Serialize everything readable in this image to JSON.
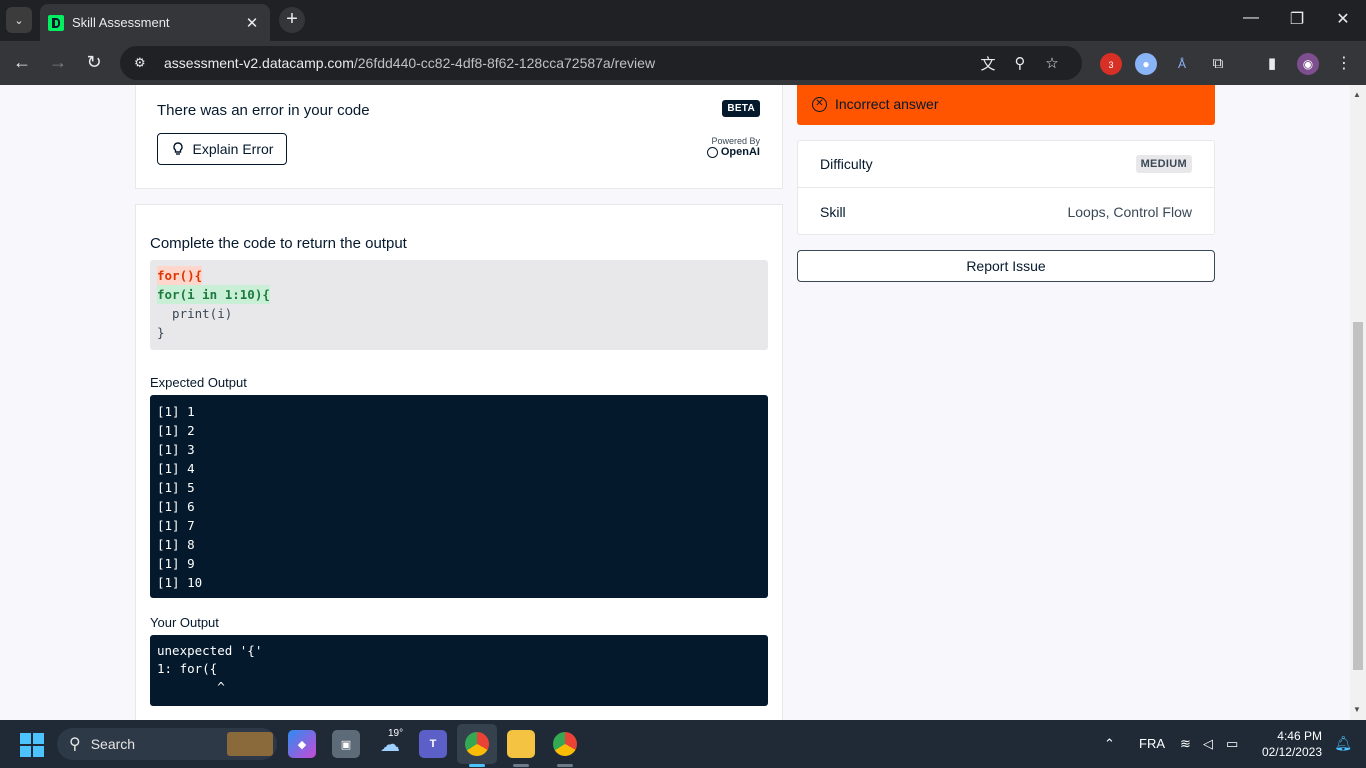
{
  "browser": {
    "tab_title": "Skill Assessment",
    "url_host": "assessment-v2.datacamp.com",
    "url_path": "/26fdd440-cc82-4df8-8f62-128cca72587a/review",
    "new_tab_glyph": "+",
    "tab_close_glyph": "✕",
    "extension_badge": "3"
  },
  "error_card": {
    "title": "There was an error in your code",
    "beta_label": "BETA",
    "explain_button": "Explain Error",
    "powered_by": "Powered By",
    "provider": "OpenAI"
  },
  "question": {
    "title": "Complete the code to return the output",
    "code": {
      "removed_line": "for(){",
      "added_line": "for(i in 1:10){",
      "body_line": "  print(i)",
      "closing_line": "}"
    },
    "expected_label": "Expected Output",
    "expected_output": "[1] 1\n[1] 2\n[1] 3\n[1] 4\n[1] 5\n[1] 6\n[1] 7\n[1] 8\n[1] 9\n[1] 10",
    "your_label": "Your Output",
    "your_output": "unexpected '{'\n1: for({\n        ^"
  },
  "result": {
    "status": "Incorrect answer",
    "difficulty_key": "Difficulty",
    "difficulty_value": "MEDIUM",
    "skill_key": "Skill",
    "skill_value": "Loops, Control Flow",
    "report_button": "Report Issue"
  },
  "taskbar": {
    "search_placeholder": "Search",
    "weather": "19°",
    "language": "FRA",
    "time": "4:46 PM",
    "date": "02/12/2023"
  },
  "colors": {
    "incorrect_banner": "#ff5400",
    "terminal_bg": "#05192d",
    "brand_green": "#03ef62"
  }
}
